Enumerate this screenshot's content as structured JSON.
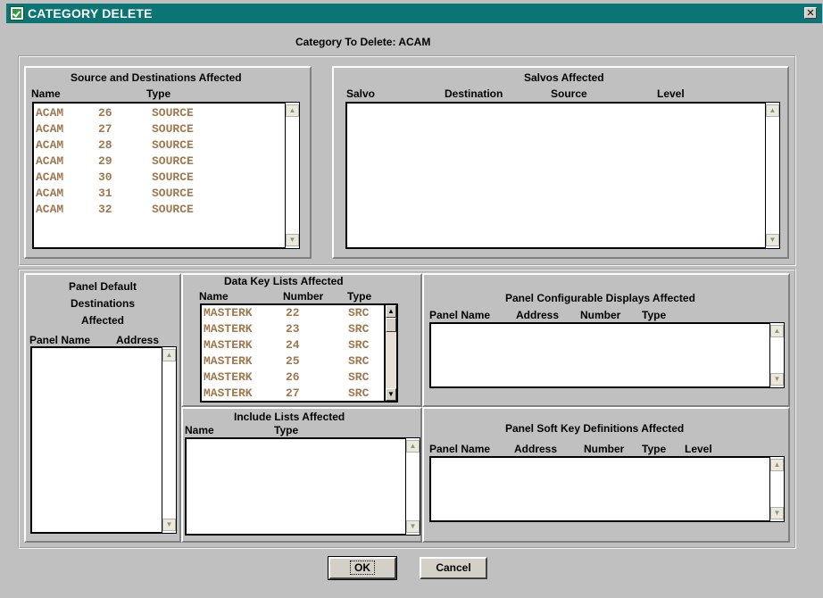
{
  "window": {
    "title": "CATEGORY DELETE",
    "close_glyph": "✕"
  },
  "category_line": "Category To Delete: ACAM",
  "source_dest": {
    "title": "Source and Destinations Affected",
    "col_name": "Name",
    "col_type": "Type",
    "rows": [
      {
        "name": "ACAM",
        "number": "26",
        "type": "SOURCE"
      },
      {
        "name": "ACAM",
        "number": "27",
        "type": "SOURCE"
      },
      {
        "name": "ACAM",
        "number": "28",
        "type": "SOURCE"
      },
      {
        "name": "ACAM",
        "number": "29",
        "type": "SOURCE"
      },
      {
        "name": "ACAM",
        "number": "30",
        "type": "SOURCE"
      },
      {
        "name": "ACAM",
        "number": "31",
        "type": "SOURCE"
      },
      {
        "name": "ACAM",
        "number": "32",
        "type": "SOURCE"
      }
    ]
  },
  "salvos": {
    "title": "Salvos  Affected",
    "col_salvo": "Salvo",
    "col_destination": "Destination",
    "col_source": "Source",
    "col_level": "Level"
  },
  "panel_default": {
    "title_line1": "Panel Default",
    "title_line2": "Destinations",
    "title_line3": "Affected",
    "col_panel_name": "Panel Name",
    "col_address": "Address"
  },
  "data_key": {
    "title": "Data Key Lists Affected",
    "col_name": "Name",
    "col_number": "Number",
    "col_type": "Type",
    "rows": [
      {
        "name": "MASTERK",
        "number": "22",
        "type": "SRC"
      },
      {
        "name": "MASTERK",
        "number": "23",
        "type": "SRC"
      },
      {
        "name": "MASTERK",
        "number": "24",
        "type": "SRC"
      },
      {
        "name": "MASTERK",
        "number": "25",
        "type": "SRC"
      },
      {
        "name": "MASTERK",
        "number": "26",
        "type": "SRC"
      },
      {
        "name": "MASTERK",
        "number": "27",
        "type": "SRC"
      }
    ]
  },
  "include_lists": {
    "title": "Include Lists Affected",
    "col_name": "Name",
    "col_type": "Type"
  },
  "panel_config": {
    "title": "Panel Configurable Displays Affected",
    "col_panel_name": "Panel Name",
    "col_address": "Address",
    "col_number": "Number",
    "col_type": "Type"
  },
  "panel_softkey": {
    "title": "Panel Soft Key Definitions Affected",
    "col_panel_name": "Panel Name",
    "col_address": "Address",
    "col_number": "Number",
    "col_type": "Type",
    "col_level": "Level"
  },
  "buttons": {
    "ok": "OK",
    "cancel": "Cancel"
  },
  "icons": {
    "window_icon": "green-check-icon",
    "scroll_up": "scroll-up-arrow-icon",
    "scroll_down": "scroll-down-arrow-icon"
  }
}
